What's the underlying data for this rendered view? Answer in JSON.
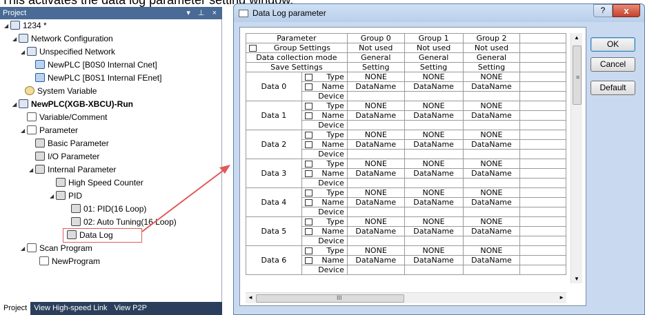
{
  "caption": "This activates the data log parameter setting window.",
  "project": {
    "title": "Project",
    "controls": "▾ ⊥ ×",
    "tree": [
      {
        "label": "1234 *"
      },
      {
        "label": "Network Configuration"
      },
      {
        "label": "Unspecified Network"
      },
      {
        "label": "NewPLC [B0S0 Internal Cnet]"
      },
      {
        "label": "NewPLC [B0S1 Internal FEnet]"
      },
      {
        "label": "System Variable"
      },
      {
        "label": "NewPLC(XGB-XBCU)-Run"
      },
      {
        "label": "Variable/Comment"
      },
      {
        "label": "Parameter"
      },
      {
        "label": "Basic Parameter"
      },
      {
        "label": "I/O Parameter"
      },
      {
        "label": "Internal Parameter"
      },
      {
        "label": "High Speed Counter"
      },
      {
        "label": "PID"
      },
      {
        "label": "01: PID(16 Loop)"
      },
      {
        "label": "02: Auto Tuning(16 Loop)"
      },
      {
        "label": "Data Log"
      },
      {
        "label": "Scan Program"
      },
      {
        "label": "NewProgram"
      }
    ],
    "tabs": [
      "Project",
      "View High-speed Link",
      "View P2P"
    ]
  },
  "dialog": {
    "title": "Data Log parameter",
    "help": "?",
    "close": "x",
    "buttons": {
      "ok": "OK",
      "cancel": "Cancel",
      "default": "Default"
    },
    "grid": {
      "header": [
        "Parameter",
        "Group 0",
        "Group 1",
        "Group 2"
      ],
      "top_rows": [
        {
          "label": "Group Settings",
          "values": [
            "Not used",
            "Not used",
            "Not used"
          ]
        },
        {
          "label": "Data collection mode",
          "values": [
            "General",
            "General",
            "General"
          ]
        },
        {
          "label": "Save Settings",
          "values": [
            "Setting",
            "Setting",
            "Setting"
          ]
        }
      ],
      "sub_labels": [
        "Type",
        "Name",
        "Device"
      ],
      "type_value": "NONE",
      "name_value": "DataName",
      "data_groups": [
        "Data 0",
        "Data 1",
        "Data 2",
        "Data 3",
        "Data 4",
        "Data 5",
        "Data 6"
      ]
    },
    "scroll": {
      "up": "▲",
      "down": "▼",
      "left": "◄",
      "right": "►",
      "vgrip": "≡",
      "hgrip": "III"
    }
  }
}
